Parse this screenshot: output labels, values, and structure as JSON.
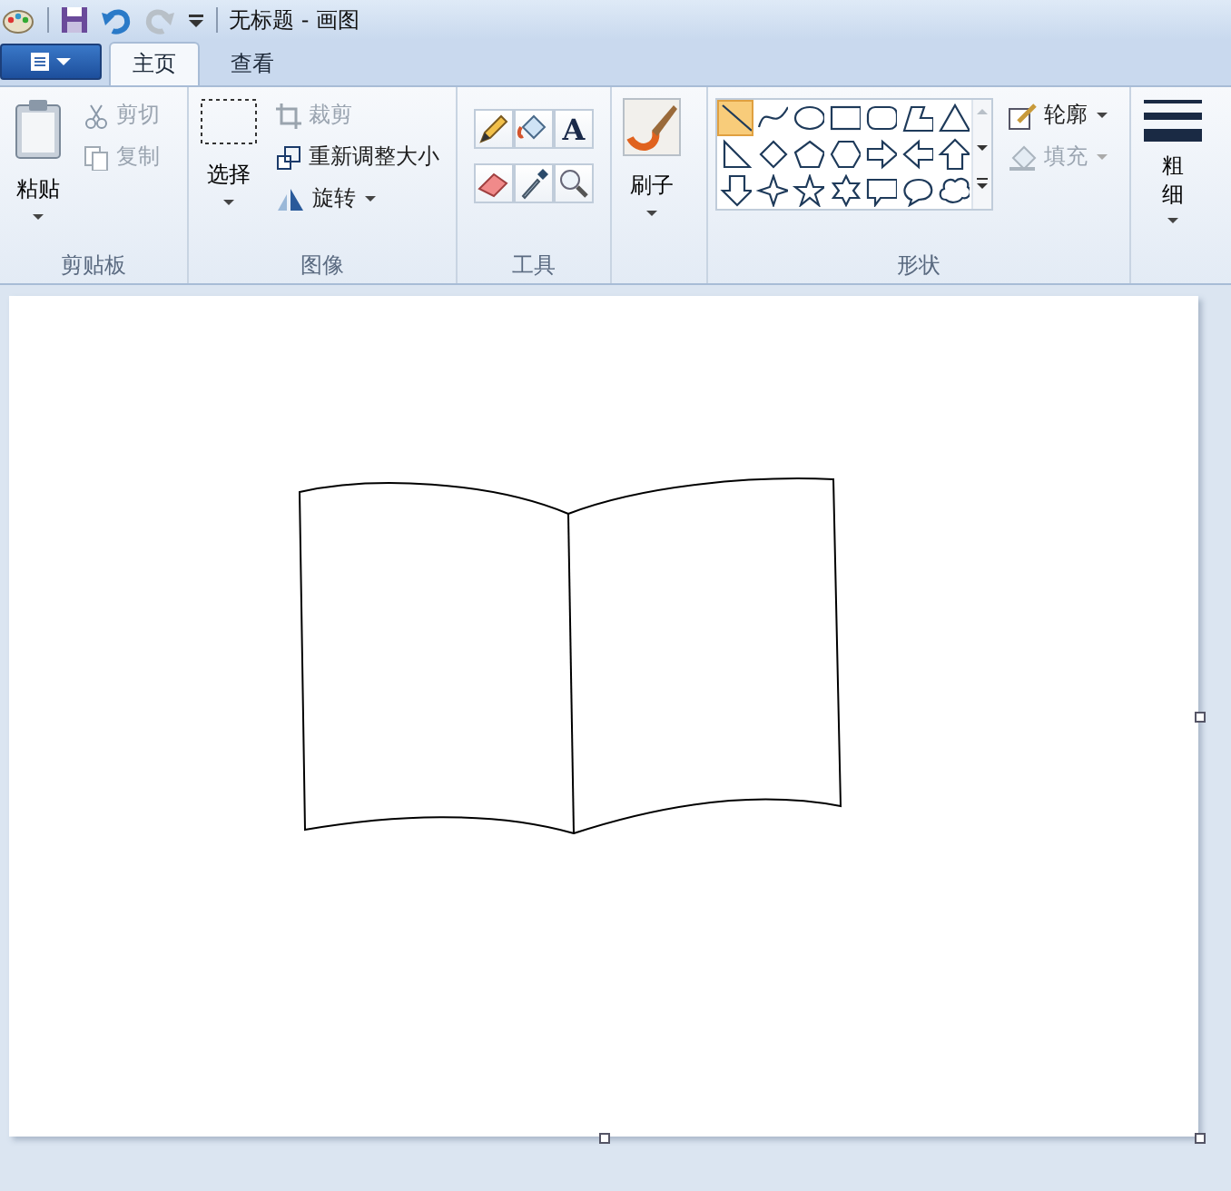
{
  "window": {
    "title": "无标题 - 画图"
  },
  "tabs": [
    {
      "label": "主页",
      "selected": true
    },
    {
      "label": "查看",
      "selected": false
    }
  ],
  "clipboard": {
    "title": "剪贴板",
    "paste": "粘贴",
    "actions": [
      {
        "kind": "cut",
        "label": "剪切",
        "disabled": true
      },
      {
        "kind": "copy",
        "label": "复制",
        "disabled": true
      }
    ]
  },
  "image": {
    "title": "图像",
    "select": "选择",
    "actions": [
      {
        "kind": "crop",
        "label": "裁剪",
        "disabled": true,
        "menu": false
      },
      {
        "kind": "resize",
        "label": "重新调整大小",
        "disabled": false,
        "menu": false
      },
      {
        "kind": "rotate",
        "label": "旋转",
        "disabled": false,
        "menu": true
      }
    ]
  },
  "tools": {
    "title": "工具",
    "items": [
      {
        "kind": "pencil"
      },
      {
        "kind": "fill"
      },
      {
        "kind": "text",
        "glyph": "A"
      },
      {
        "kind": "eraser"
      },
      {
        "kind": "picker"
      },
      {
        "kind": "magnifier"
      }
    ]
  },
  "brushes": {
    "label": "刷子"
  },
  "shapes": {
    "title": "形状",
    "items": [
      {
        "kind": "line",
        "selected": true
      },
      {
        "kind": "curve",
        "selected": false
      },
      {
        "kind": "oval",
        "selected": false
      },
      {
        "kind": "rect",
        "selected": false
      },
      {
        "kind": "roundrect",
        "selected": false
      },
      {
        "kind": "polygon",
        "selected": false
      },
      {
        "kind": "triangle",
        "selected": false
      },
      {
        "kind": "right-triangle",
        "selected": false
      },
      {
        "kind": "diamond",
        "selected": false
      },
      {
        "kind": "pentagon",
        "selected": false
      },
      {
        "kind": "hexagon",
        "selected": false
      },
      {
        "kind": "arrow-right",
        "selected": false
      },
      {
        "kind": "arrow-left",
        "selected": false
      },
      {
        "kind": "arrow-up",
        "selected": false
      },
      {
        "kind": "arrow-down",
        "selected": false
      },
      {
        "kind": "star4",
        "selected": false
      },
      {
        "kind": "star5",
        "selected": false
      },
      {
        "kind": "star6",
        "selected": false
      },
      {
        "kind": "callout-rect",
        "selected": false
      },
      {
        "kind": "callout-oval",
        "selected": false
      },
      {
        "kind": "callout-cloud",
        "selected": false
      }
    ],
    "outline": {
      "label": "轮廓",
      "disabled": false
    },
    "fill": {
      "label": "填充",
      "disabled": true
    }
  },
  "size": {
    "label": "粗细"
  }
}
